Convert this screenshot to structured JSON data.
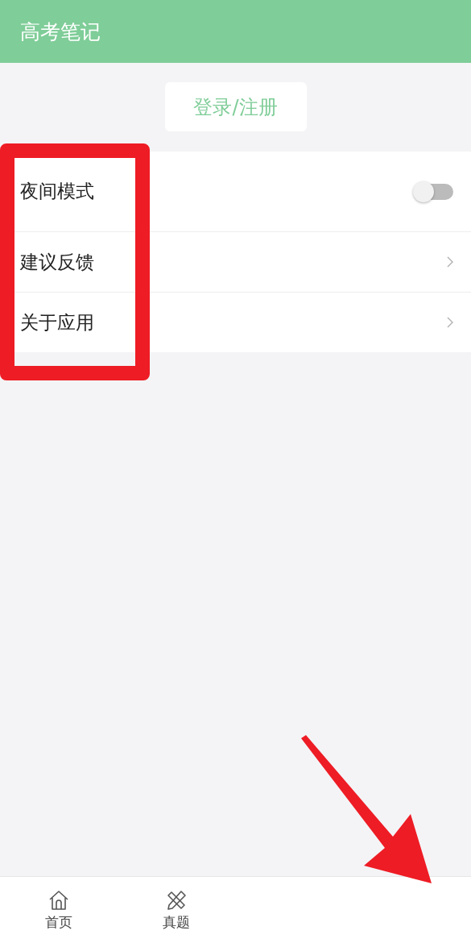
{
  "header": {
    "title": "高考笔记"
  },
  "login_button": {
    "label": "登录/注册"
  },
  "settings": [
    {
      "kind": "toggle",
      "label": "夜间模式",
      "on": false
    },
    {
      "kind": "link",
      "label": "建议反馈"
    },
    {
      "kind": "link",
      "label": "关于应用"
    }
  ],
  "tab_bar": [
    {
      "label": "首页",
      "kind": "home"
    },
    {
      "label": "真题",
      "kind": "exam"
    }
  ]
}
